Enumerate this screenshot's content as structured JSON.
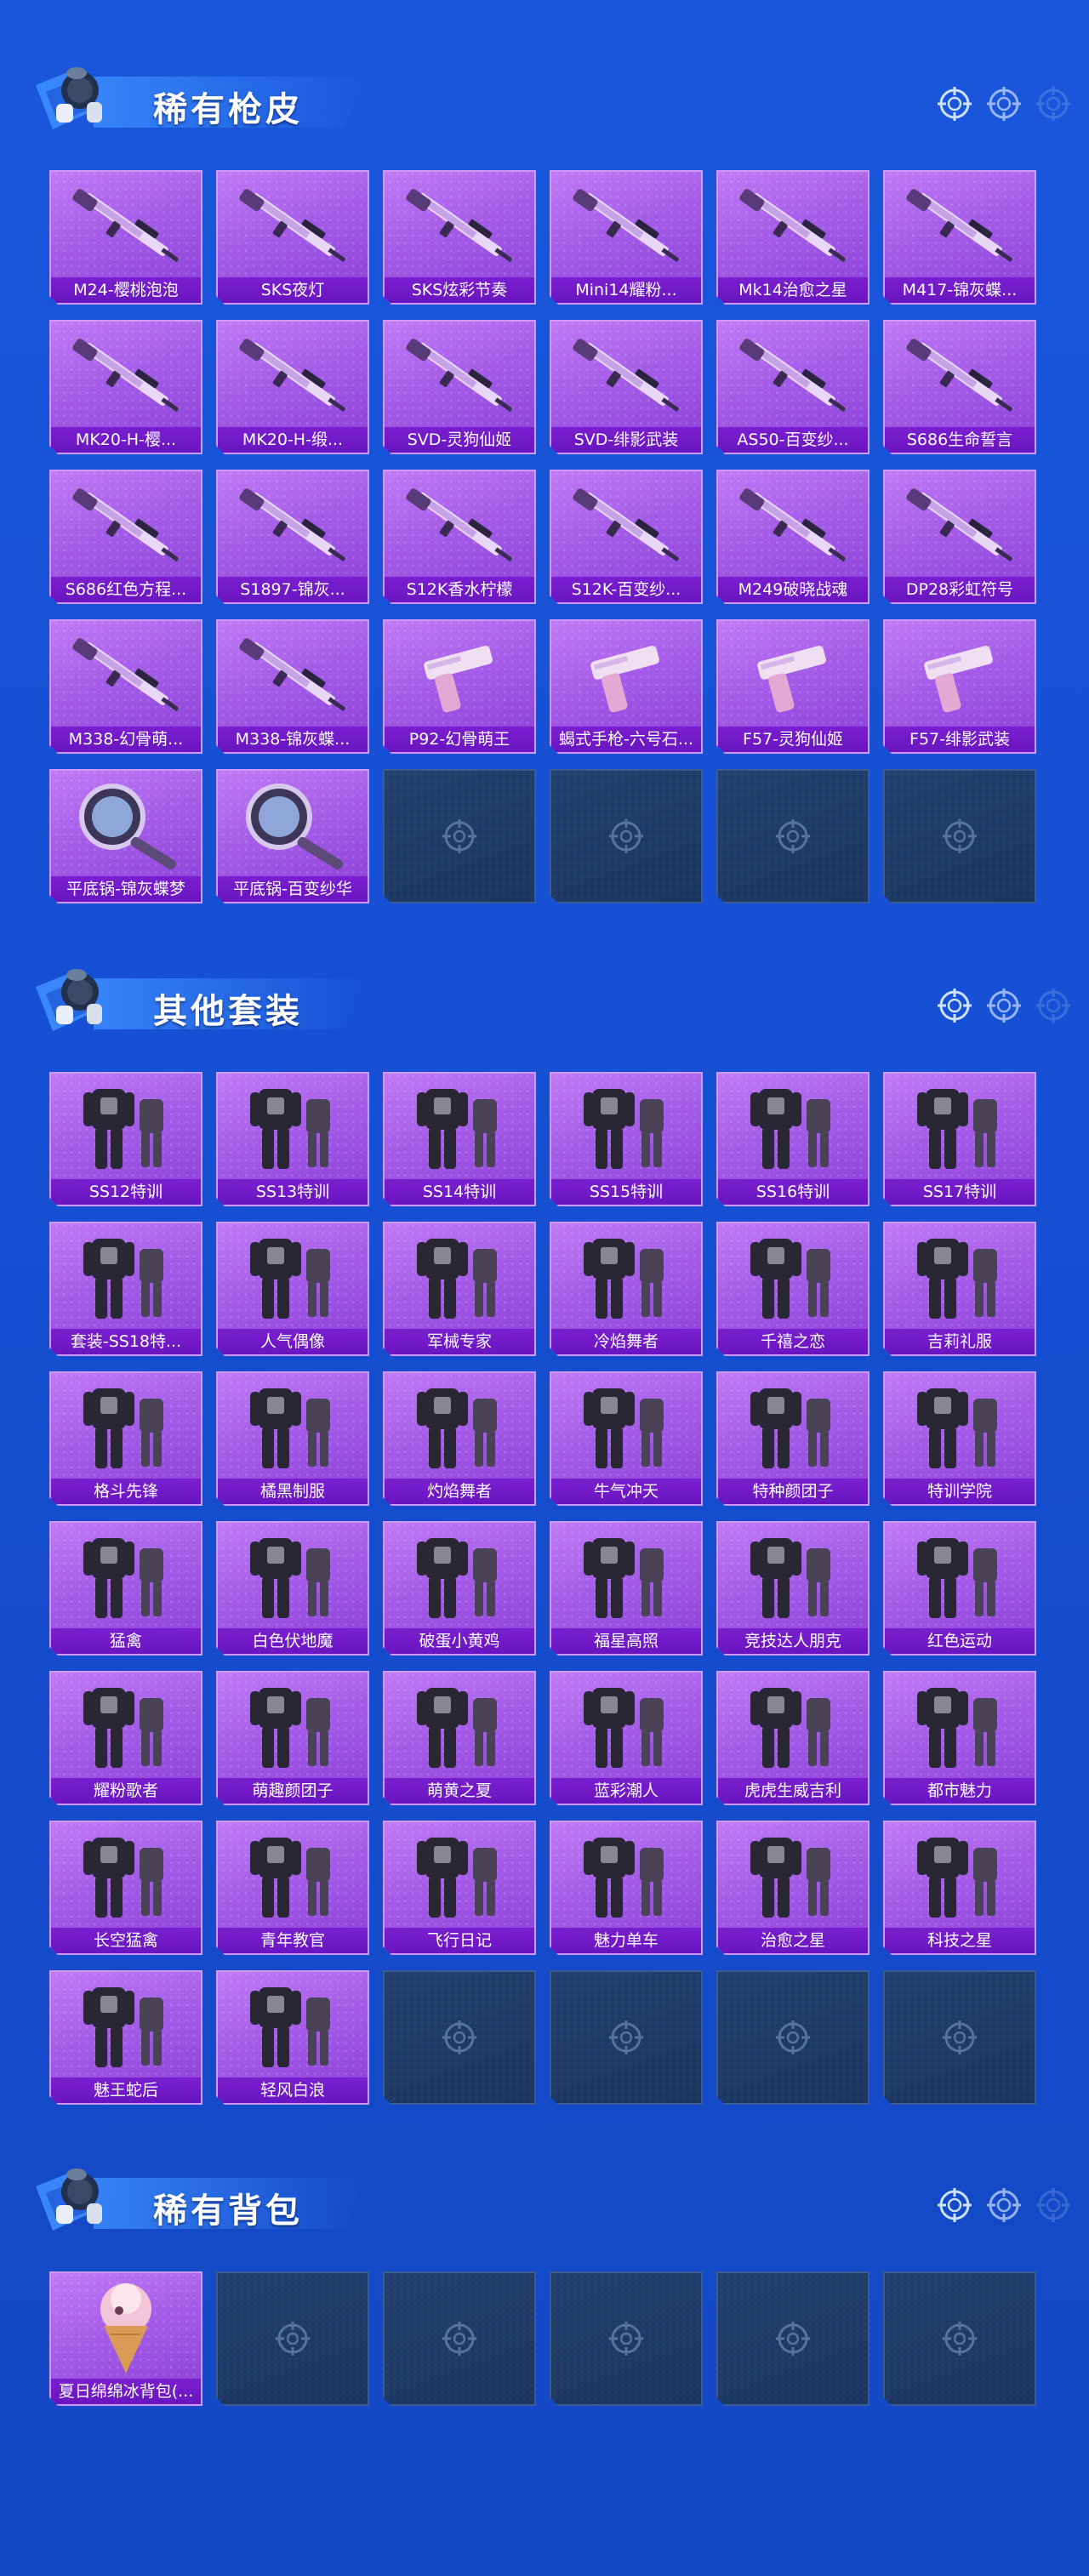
{
  "sections": [
    {
      "title": "稀有枪皮",
      "items": [
        {
          "name": "M24-樱桃泡泡",
          "icon": "rifle"
        },
        {
          "name": "SKS夜灯",
          "icon": "rifle"
        },
        {
          "name": "SKS炫彩节奏",
          "icon": "rifle"
        },
        {
          "name": "Mini14耀粉...",
          "icon": "rifle"
        },
        {
          "name": "Mk14治愈之星",
          "icon": "rifle"
        },
        {
          "name": "M417-锦灰蝶...",
          "icon": "rifle"
        },
        {
          "name": "MK20-H-樱...",
          "icon": "rifle"
        },
        {
          "name": "MK20-H-缎...",
          "icon": "rifle"
        },
        {
          "name": "SVD-灵狗仙姬",
          "icon": "rifle"
        },
        {
          "name": "SVD-绯影武装",
          "icon": "rifle"
        },
        {
          "name": "AS50-百变纱...",
          "icon": "rifle"
        },
        {
          "name": "S686生命誓言",
          "icon": "shotgun"
        },
        {
          "name": "S686红色方程...",
          "icon": "shotgun"
        },
        {
          "name": "S1897-锦灰...",
          "icon": "shotgun"
        },
        {
          "name": "S12K香水柠檬",
          "icon": "rifle"
        },
        {
          "name": "S12K-百变纱...",
          "icon": "rifle"
        },
        {
          "name": "M249破晓战魂",
          "icon": "rifle"
        },
        {
          "name": "DP28彩虹符号",
          "icon": "rifle"
        },
        {
          "name": "M338-幻骨萌...",
          "icon": "rifle"
        },
        {
          "name": "M338-锦灰蝶...",
          "icon": "rifle"
        },
        {
          "name": "P92-幻骨萌王",
          "icon": "pistol"
        },
        {
          "name": "蝎式手枪-六号石...",
          "icon": "pistol"
        },
        {
          "name": "F57-灵狗仙姬",
          "icon": "pistol"
        },
        {
          "name": "F57-绯影武装",
          "icon": "pistol"
        },
        {
          "name": "平底锅-锦灰蝶梦",
          "icon": "pan"
        },
        {
          "name": "平底锅-百变纱华",
          "icon": "pan"
        }
      ],
      "empty_slots": 4
    },
    {
      "title": "其他套装",
      "items": [
        {
          "name": "SS12特训",
          "icon": "outfit"
        },
        {
          "name": "SS13特训",
          "icon": "outfit"
        },
        {
          "name": "SS14特训",
          "icon": "outfit"
        },
        {
          "name": "SS15特训",
          "icon": "outfit"
        },
        {
          "name": "SS16特训",
          "icon": "outfit"
        },
        {
          "name": "SS17特训",
          "icon": "outfit"
        },
        {
          "name": "套装-SS18特...",
          "icon": "outfit"
        },
        {
          "name": "人气偶像",
          "icon": "outfit"
        },
        {
          "name": "军械专家",
          "icon": "outfit"
        },
        {
          "name": "冷焰舞者",
          "icon": "outfit"
        },
        {
          "name": "千禧之恋",
          "icon": "outfit"
        },
        {
          "name": "吉莉礼服",
          "icon": "outfit"
        },
        {
          "name": "格斗先锋",
          "icon": "outfit"
        },
        {
          "name": "橘黑制服",
          "icon": "outfit"
        },
        {
          "name": "灼焰舞者",
          "icon": "outfit"
        },
        {
          "name": "牛气冲天",
          "icon": "outfit"
        },
        {
          "name": "特种颜团子",
          "icon": "outfit"
        },
        {
          "name": "特训学院",
          "icon": "outfit"
        },
        {
          "name": "猛禽",
          "icon": "outfit"
        },
        {
          "name": "白色伏地魔",
          "icon": "outfit"
        },
        {
          "name": "破蛋小黄鸡",
          "icon": "outfit"
        },
        {
          "name": "福星高照",
          "icon": "outfit"
        },
        {
          "name": "竞技达人朋克",
          "icon": "outfit"
        },
        {
          "name": "红色运动",
          "icon": "outfit"
        },
        {
          "name": "耀粉歌者",
          "icon": "outfit"
        },
        {
          "name": "萌趣颜团子",
          "icon": "outfit"
        },
        {
          "name": "萌黄之夏",
          "icon": "outfit"
        },
        {
          "name": "蓝彩潮人",
          "icon": "outfit"
        },
        {
          "name": "虎虎生威吉利",
          "icon": "outfit"
        },
        {
          "name": "都市魅力",
          "icon": "outfit"
        },
        {
          "name": "长空猛禽",
          "icon": "outfit"
        },
        {
          "name": "青年教官",
          "icon": "outfit"
        },
        {
          "name": "飞行日记",
          "icon": "outfit"
        },
        {
          "name": "魅力单车",
          "icon": "outfit"
        },
        {
          "name": "治愈之星",
          "icon": "outfit"
        },
        {
          "name": "科技之星",
          "icon": "outfit"
        },
        {
          "name": "魅王蛇后",
          "icon": "outfit"
        },
        {
          "name": "轻风白浪",
          "icon": "outfit"
        }
      ],
      "empty_slots": 4
    },
    {
      "title": "稀有背包",
      "items": [
        {
          "name": "夏日绵绵冰背包(...",
          "icon": "backpack"
        }
      ],
      "empty_slots": 5
    }
  ]
}
